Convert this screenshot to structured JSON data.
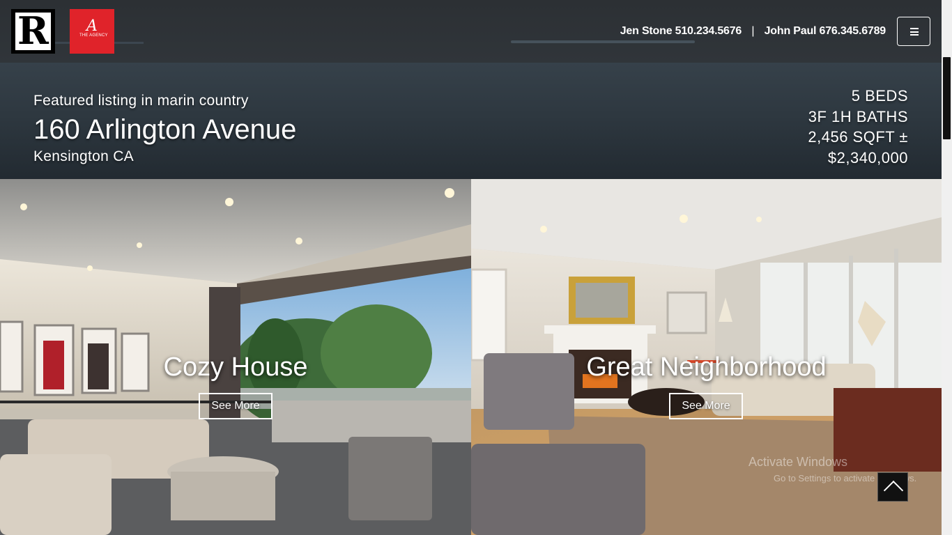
{
  "header": {
    "contacts": [
      {
        "name": "Jen Stone",
        "phone": "510.234.5676"
      },
      {
        "name": "John Paul",
        "phone": "676.345.6789"
      }
    ],
    "separator": "|",
    "logo_primary_icon": "realtor-r-logo",
    "logo_secondary_icon": "the-agency-logo",
    "logo_secondary_text": "THE AGENCY",
    "menu_icon": "hamburger-menu-icon"
  },
  "listing": {
    "kicker": "Featured listing in marin country",
    "address": "160 Arlington Avenue",
    "city": "Kensington CA",
    "specs": {
      "beds": "5 BEDS",
      "baths": "3F 1H BATHS",
      "sqft": "2,456 SQFT ±",
      "price": "$2,340,000"
    }
  },
  "cards": [
    {
      "title": "Cozy House",
      "button_label": "See More",
      "image": "living-room-with-view-photo"
    },
    {
      "title": "Great Neighborhood",
      "button_label": "See More",
      "image": "living-room-with-fireplace-photo"
    }
  ],
  "overlay": {
    "watermark_title": "Activate Windows",
    "watermark_sub": "Go to Settings to activate Windows.",
    "scroll_top_icon": "chevron-up-icon"
  },
  "colors": {
    "header_bg": "#2f3337",
    "banner_bg": "#2e3840",
    "agency_red": "#e0232a",
    "text": "#ffffff"
  }
}
